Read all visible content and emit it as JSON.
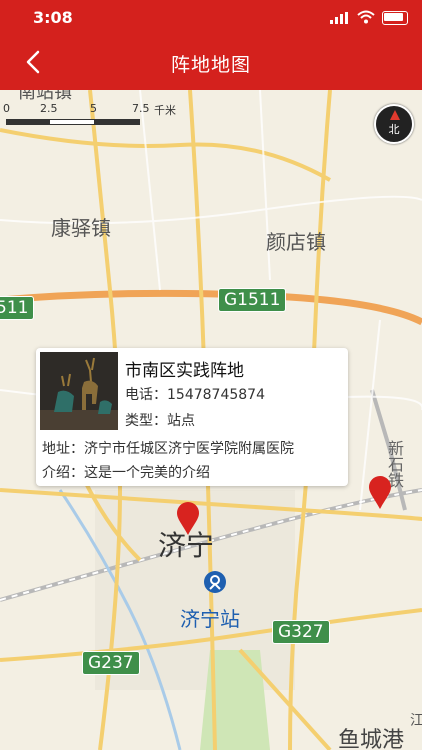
{
  "status_bar": {
    "time": "3:08"
  },
  "nav": {
    "title": "阵地地图"
  },
  "scale": {
    "ticks": [
      "0",
      "2.5",
      "5",
      "7.5"
    ],
    "unit": "千米"
  },
  "compass": {
    "label": "北"
  },
  "map_labels": {
    "top_fragment": "南站镇",
    "kangyi": "康驿镇",
    "yandian": "颜店镇",
    "jining": "济宁",
    "jining_station": "济宁站",
    "xinshi_line": "新石铁",
    "bottom_right": "鱼城港",
    "bottom_right_cut": "江"
  },
  "road_shields": {
    "g1511_left": "511",
    "g1511_center": "G1511",
    "g327": "G327",
    "g237": "G237"
  },
  "popup": {
    "name": "市南区实践阵地",
    "phone": "电话：15478745874",
    "type": "类型：站点",
    "address": "地址：济宁市任城区济宁医学院附属医院",
    "intro": "介绍：这是一个完美的介绍"
  },
  "colors": {
    "header": "#d4211d",
    "marker": "#d8231f",
    "shield": "#3f8f4a",
    "expressway": "#f0a457",
    "road": "#f4cf70"
  }
}
